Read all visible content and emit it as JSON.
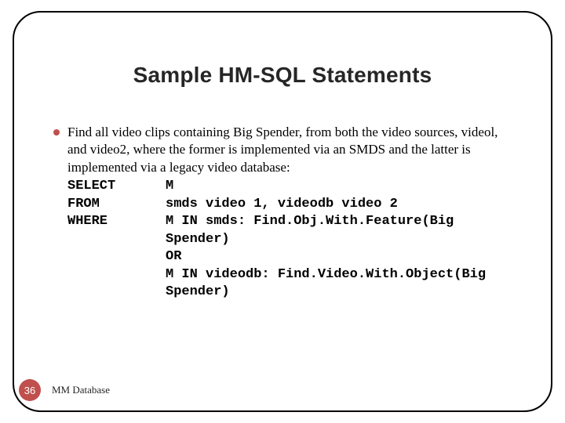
{
  "title": "Sample HM-SQL Statements",
  "bullet": {
    "intro": "Find all video clips containing Big Spender, from both the video sources, videol, and video2, where the former is implemented via an SMDS and the latter is implemented via a legacy video database:",
    "sql": {
      "select_kw": "SELECT",
      "select_val": "M",
      "from_kw": "FROM",
      "from_val": "smds video 1, videodb video 2",
      "where_kw": "WHERE",
      "where_val": "M IN smds: Find.Obj.With.Feature(Big Spender)",
      "cont1": "OR",
      "cont2": "M IN videodb: Find.Video.With.Object(Big Spender)"
    }
  },
  "footer": {
    "page": "36",
    "label": "MM Database"
  }
}
